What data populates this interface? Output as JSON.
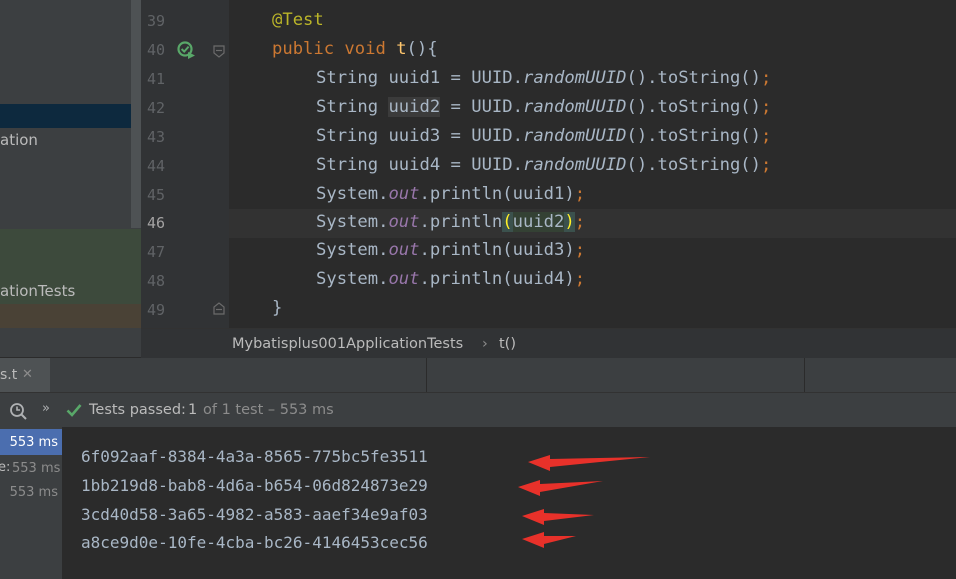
{
  "project_panel": {
    "item_partial_1": "ation",
    "item_partial_2": "ationTests"
  },
  "gutter": {
    "line_numbers": [
      "39",
      "40",
      "41",
      "42",
      "43",
      "44",
      "45",
      "46",
      "47",
      "48",
      "49"
    ]
  },
  "editor": {
    "annotation": "@Test",
    "method_kw": "public void ",
    "method_name": "t",
    "method_tail": "(){",
    "uuid_vars": [
      "uuid1",
      "uuid2",
      "uuid3",
      "uuid4"
    ],
    "string_type": "String ",
    "uuid_expr_a": " = UUID.",
    "uuid_expr_fn": "randomUUID",
    "uuid_expr_b": "().toString()",
    "semicolon": ";",
    "sys": "System.",
    "out": "out",
    "println": ".println(",
    "close_paren": ")",
    "close_brace": "}"
  },
  "breadcrumb": {
    "class_name": "Mybatisplus001ApplicationTests",
    "separator": "›",
    "method": "t()"
  },
  "run_tab": {
    "label": "s.t",
    "close": "✕"
  },
  "toolbar": {
    "passed_label": "Tests passed:",
    "passed_count": "1",
    "passed_rest": "of 1 test – 553 ms"
  },
  "test_tree": {
    "times": [
      "553 ms",
      "553 ms",
      "553 ms"
    ],
    "partial_label": "e:"
  },
  "console": {
    "lines": [
      "6f092aaf-8384-4a3a-8565-775bc5fe3511",
      "1bb219d8-bab8-4d6a-b654-06d824873e29",
      "3cd40d58-3a65-4982-a583-aaef34e9af03",
      "a8ce9d0e-10fe-4cba-bc26-4146453cec56"
    ]
  },
  "colors": {
    "accent_green": "#59a869",
    "arrow_red": "#e8312a",
    "selection_blue": "#4b6eaf"
  }
}
